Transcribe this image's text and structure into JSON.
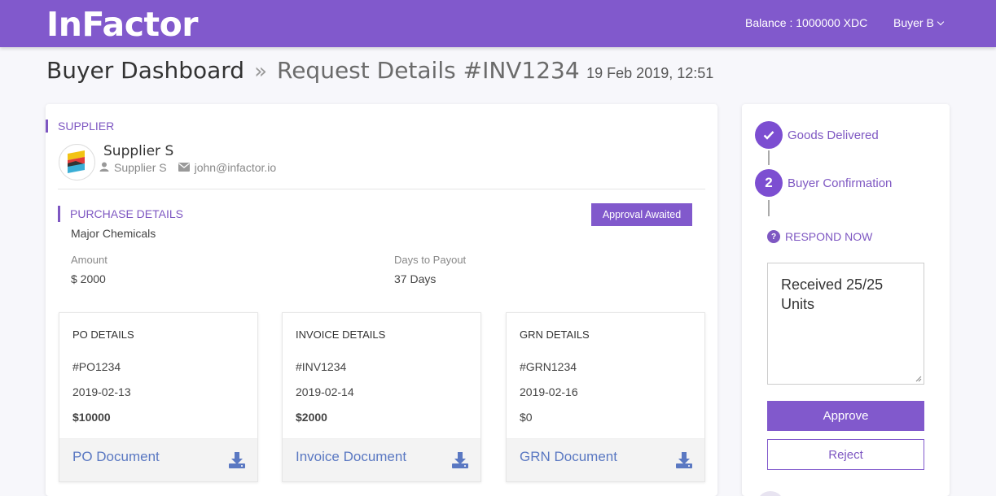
{
  "header": {
    "logo": "InFactor",
    "balance": "Balance : 1000000 XDC",
    "user": "Buyer B"
  },
  "breadcrumb": {
    "root": "Buyer Dashboard",
    "separator": "»",
    "current": "Request Details #INV1234",
    "date": "19 Feb 2019, 12:51"
  },
  "supplier": {
    "section_title": "SUPPLIER",
    "name": "Supplier S",
    "contact": "Supplier S",
    "email": "john@infactor.io"
  },
  "purchase": {
    "section_title": "PURCHASE DETAILS",
    "status_badge": "Approval Awaited",
    "description": "Major Chemicals",
    "amount_label": "Amount",
    "amount_value": "$ 2000",
    "days_label": "Days to Payout",
    "days_value": "37 Days"
  },
  "documents": [
    {
      "title": "PO DETAILS",
      "id": "#PO1234",
      "date": "2019-02-13",
      "amount": "$10000",
      "link": "PO Document"
    },
    {
      "title": "INVOICE DETAILS",
      "id": "#INV1234",
      "date": "2019-02-14",
      "amount": "$2000",
      "link": "Invoice Document"
    },
    {
      "title": "GRN DETAILS",
      "id": "#GRN1234",
      "date": "2019-02-16",
      "amount": "$0",
      "link": "GRN Document"
    }
  ],
  "workflow": {
    "step1_label": "Goods Delivered",
    "step2_number": "2",
    "step2_label": "Buyer Confirmation",
    "respond_label": "RESPOND NOW",
    "note_text": "Received 25/25 Units",
    "approve_label": "Approve",
    "reject_label": "Reject"
  },
  "colors": {
    "brand": "#8159cc",
    "accent": "#7e57c2",
    "link": "#5a78c2",
    "background": "#f7f7fb"
  },
  "icons": {
    "user_menu": "chevron-down-icon",
    "contact": "user-icon",
    "email": "envelope-icon",
    "download": "download-icon",
    "step_done": "check-icon",
    "respond": "question-icon"
  }
}
